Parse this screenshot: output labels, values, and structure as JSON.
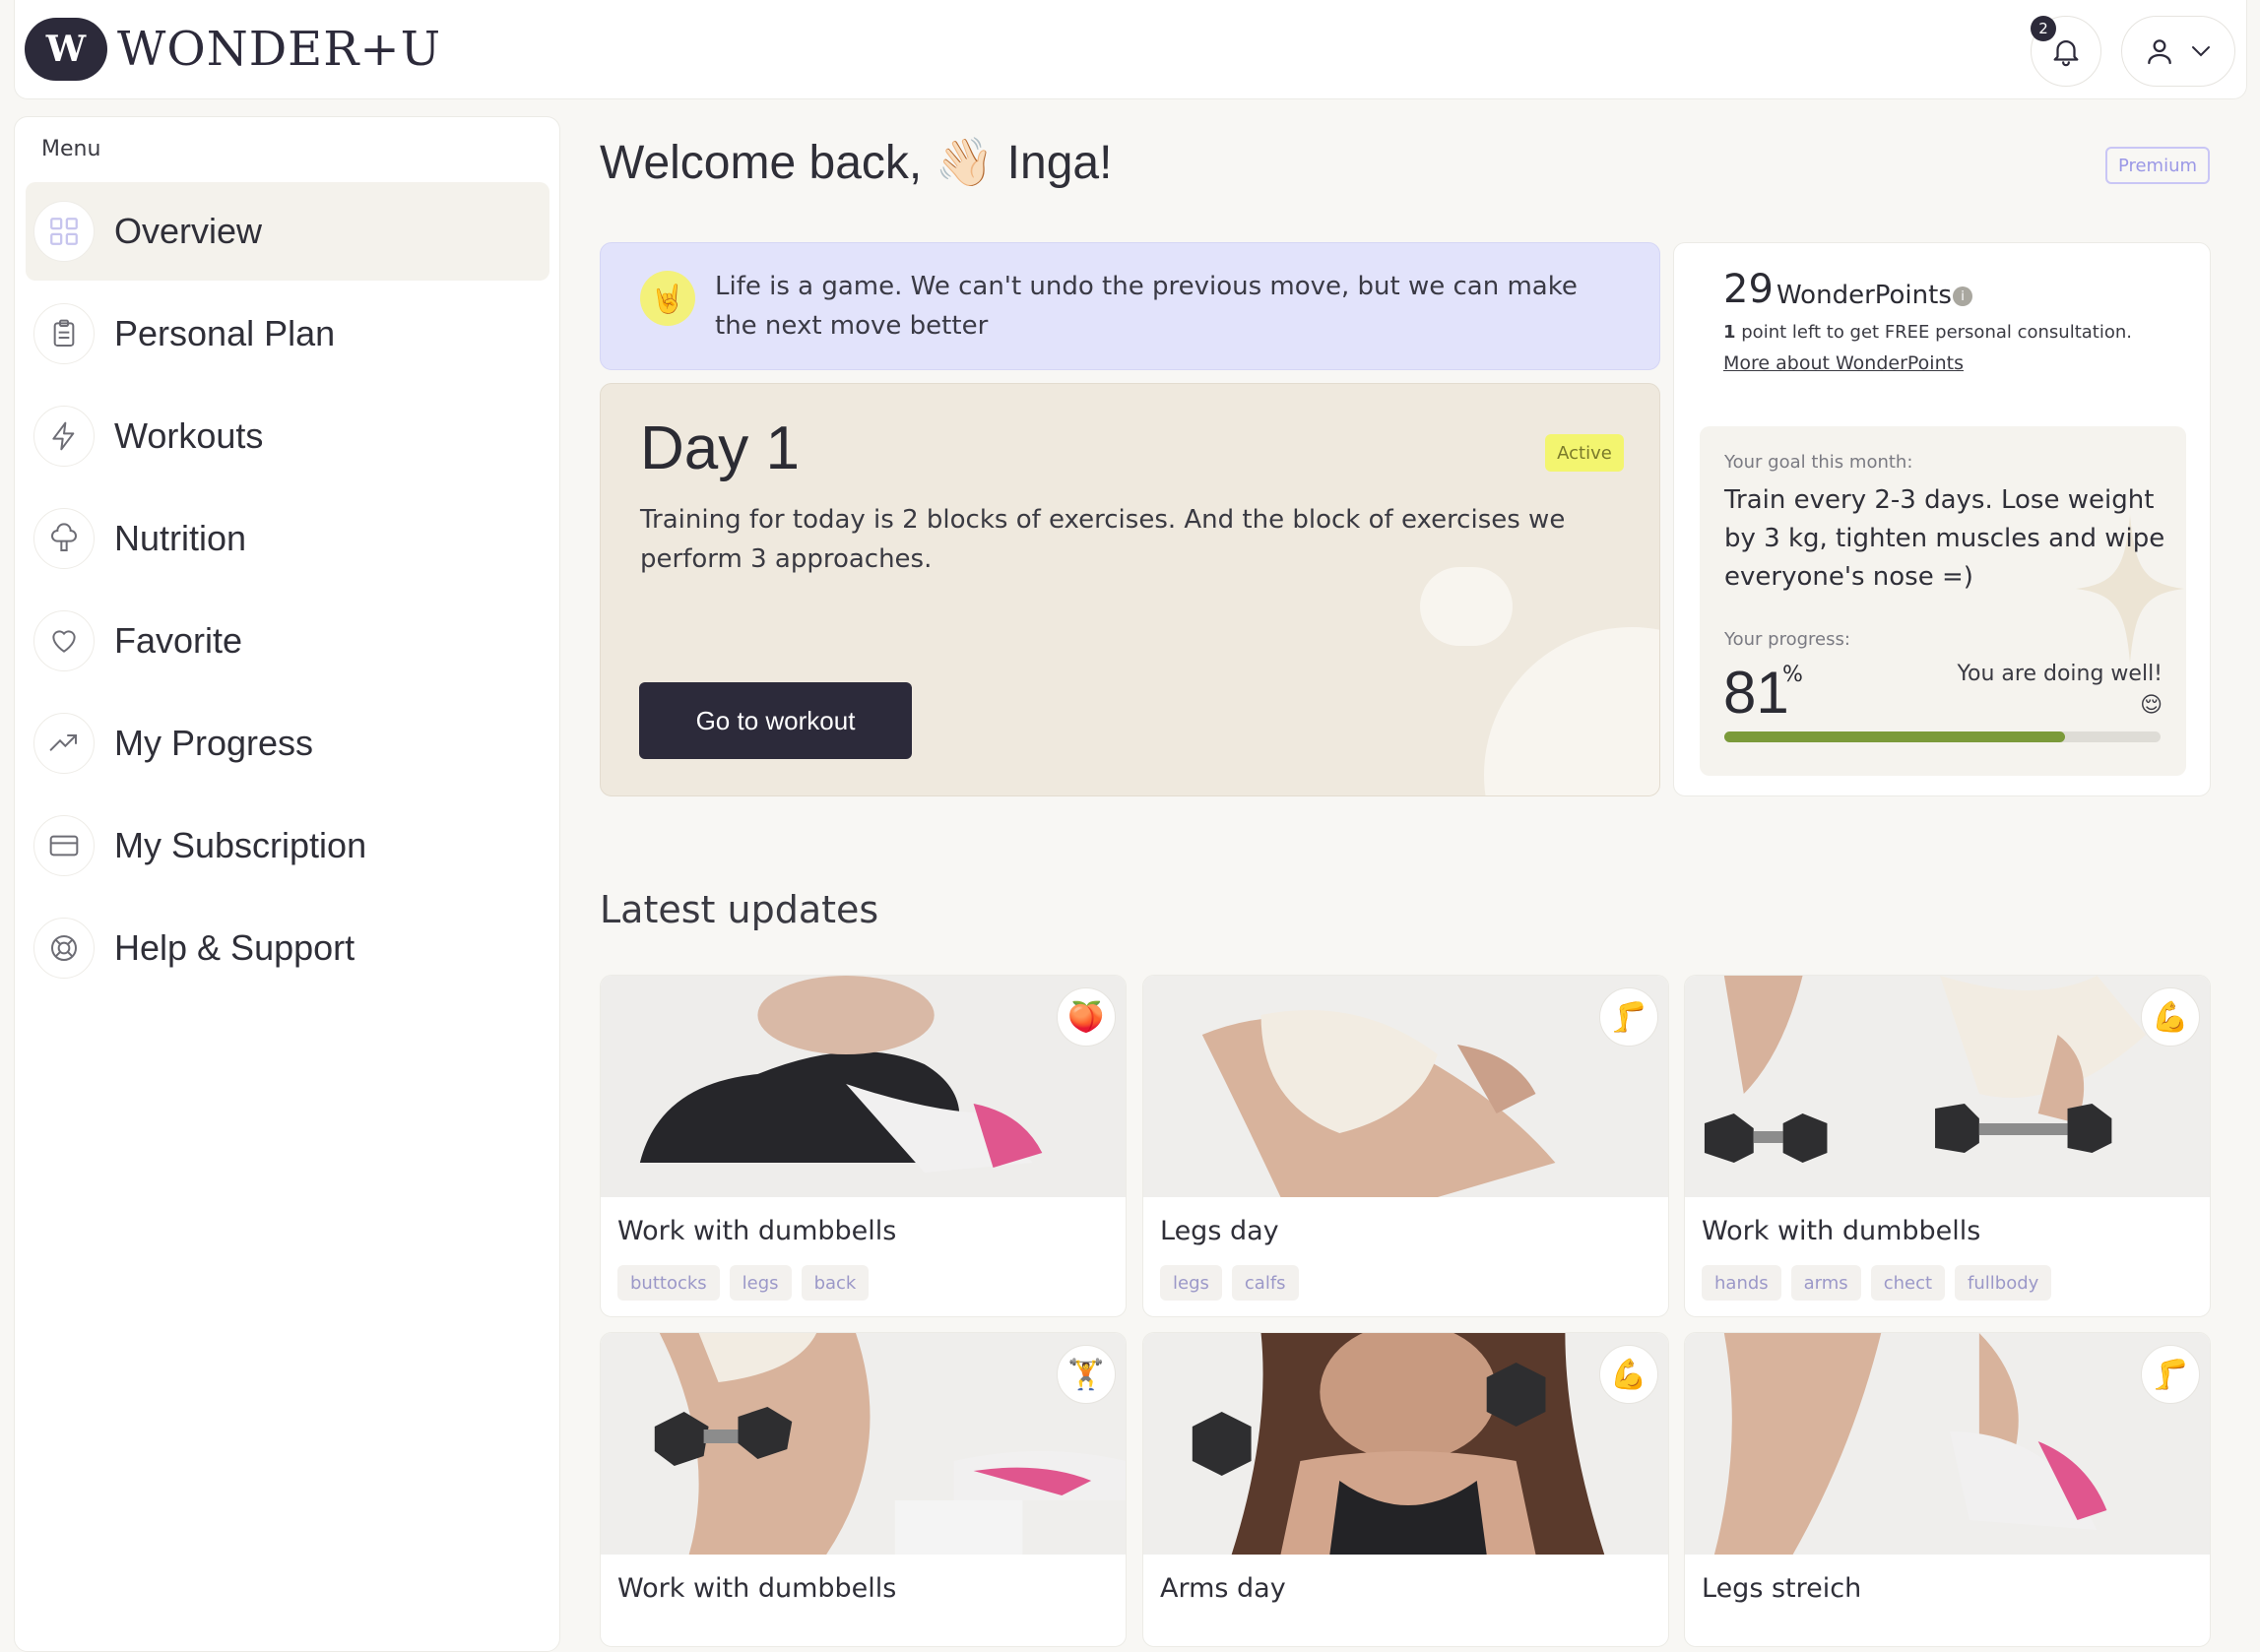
{
  "header": {
    "logo_mark": "W",
    "logo_text": "WONDER+U",
    "notifications_count": "2"
  },
  "sidebar": {
    "menu_label": "Menu",
    "items": [
      {
        "label": "Overview",
        "icon": "grid-icon",
        "active": true
      },
      {
        "label": "Personal Plan",
        "icon": "clipboard-icon"
      },
      {
        "label": "Workouts",
        "icon": "lightning-icon"
      },
      {
        "label": "Nutrition",
        "icon": "broccoli-icon"
      },
      {
        "label": "Favorite",
        "icon": "heart-icon"
      },
      {
        "label": "My Progress",
        "icon": "trend-up-icon"
      },
      {
        "label": "My Subscription",
        "icon": "credit-card-icon"
      },
      {
        "label": "Help & Support",
        "icon": "lifebuoy-icon"
      }
    ]
  },
  "main": {
    "welcome": "Welcome back, 👋🏻 Inga!",
    "premium_badge": "Premium",
    "quote": {
      "emoji": "🤘",
      "text": "Life is a game. We can't undo the previous move, but we can make the next move better"
    },
    "day": {
      "title": "Day 1",
      "status": "Active",
      "description": "Training for today is 2 blocks of exercises. And the block of exercises we perform 3 approaches.",
      "button": "Go to workout"
    },
    "points": {
      "value": "29",
      "label": "WonderPoints",
      "info": "i",
      "note_count": "1",
      "note_text": " point left to get FREE personal consultation.",
      "link": "More about WonderPoints",
      "goal_label": "Your goal this month:",
      "goal_text": "Train every 2-3 days. Lose weight by 3 kg, tighten muscles and wipe everyone's nose =)",
      "progress_label": "Your progress:",
      "progress_value": "81",
      "progress_unit": "%",
      "progress_fraction": 0.78,
      "progress_message": "You are doing well! 😌",
      "progress_color": "#7b9a3a"
    },
    "updates_title": "Latest updates",
    "cards": [
      {
        "title": "Work with dumbbells",
        "emoji": "🍑",
        "tags": [
          "buttocks",
          "legs",
          "back"
        ]
      },
      {
        "title": "Legs day",
        "emoji": "🦵",
        "tags": [
          "legs",
          "calfs"
        ]
      },
      {
        "title": "Work with dumbbells",
        "emoji": "💪",
        "tags": [
          "hands",
          "arms",
          "chect",
          "fullbody"
        ]
      },
      {
        "title": "Work with dumbbells",
        "emoji": "🏋️",
        "tags": []
      },
      {
        "title": "Arms day",
        "emoji": "💪",
        "tags": []
      },
      {
        "title": "Legs streich",
        "emoji": "🦵",
        "tags": []
      }
    ]
  },
  "colors": {
    "accent_dark": "#2c2a3a",
    "quote_bg": "#e2e3fb",
    "day_bg": "#efe9de",
    "active_badge": "#f3f56f"
  }
}
